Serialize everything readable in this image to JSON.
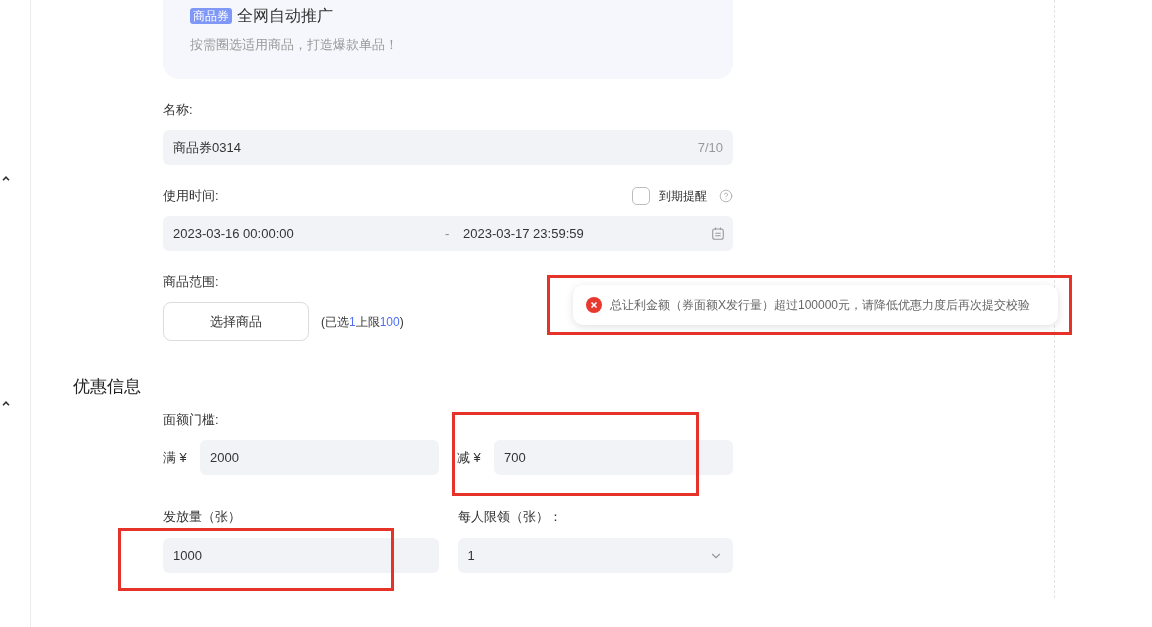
{
  "promo_card": {
    "badge": "商品券",
    "title": "全网自动推广",
    "subtitle": "按需圈选适用商品，打造爆款单品！"
  },
  "name_field": {
    "label": "名称:",
    "value": "商品券0314",
    "counter": "7/10"
  },
  "time_field": {
    "label": "使用时间:",
    "reminder": {
      "label": "到期提醒",
      "checked": false
    },
    "start": "2023-03-16 00:00:00",
    "separator": "-",
    "end": "2023-03-17 23:59:59"
  },
  "scope_field": {
    "label": "商品范围:",
    "button": "选择商品",
    "note": [
      {
        "text": "(已选",
        "kind": "plain"
      },
      {
        "text": "1",
        "kind": "number"
      },
      {
        "text": "上限",
        "kind": "plain"
      },
      {
        "text": "100",
        "kind": "number"
      },
      {
        "text": ")",
        "kind": "plain"
      }
    ]
  },
  "toast": {
    "message": "总让利金额（券面额X发行量）超过100000元，请降低优惠力度后再次提交校验",
    "highlighted": true
  },
  "discount_section": {
    "title": "优惠信息",
    "threshold": {
      "label": "面额门槛:",
      "fields": [
        {
          "prefix": "满 ¥",
          "value": "2000",
          "highlighted": false
        },
        {
          "prefix": "减 ¥",
          "value": "700",
          "highlighted": true
        }
      ]
    },
    "limits": [
      {
        "label": "发放量（张）",
        "value": "1000",
        "kind": "input",
        "highlighted": true
      },
      {
        "label": "每人限领（张）：",
        "value": "1",
        "kind": "select",
        "highlighted": false
      }
    ]
  }
}
